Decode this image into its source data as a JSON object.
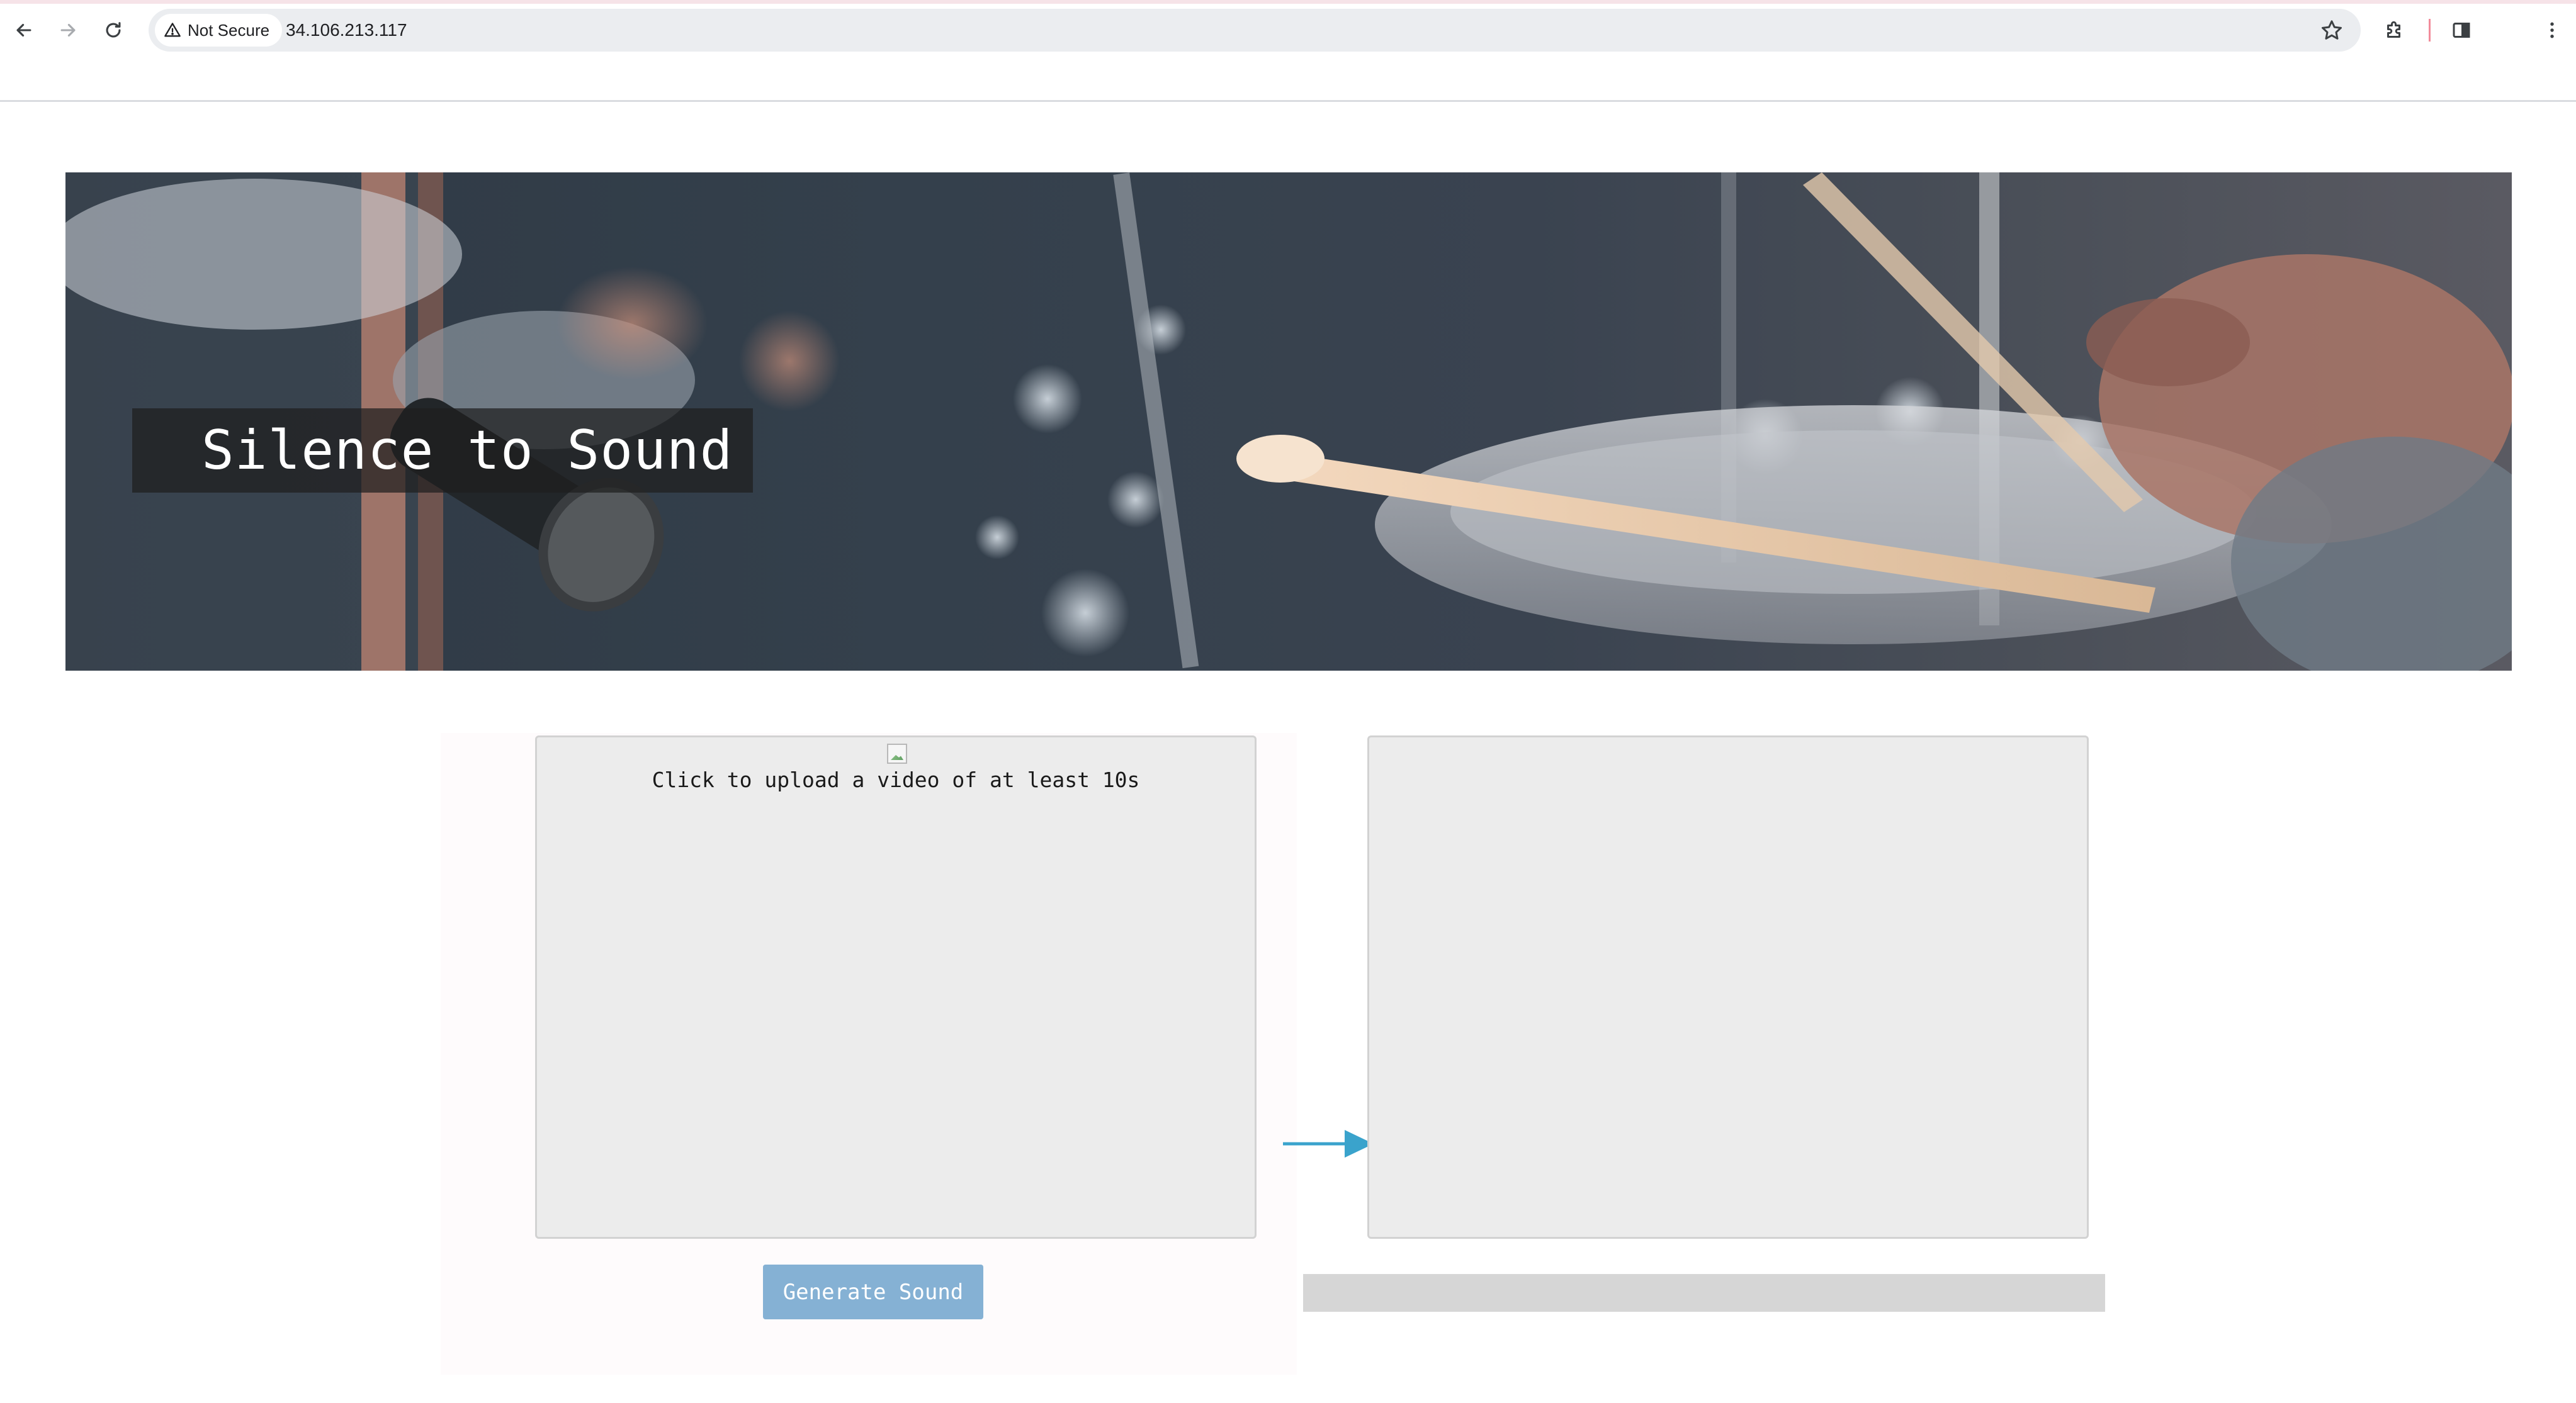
{
  "browser": {
    "security_label": "Not Secure",
    "url": "34.106.213.117"
  },
  "hero": {
    "title": "Silence to Sound"
  },
  "upload_panel": {
    "label": "Click to upload a video of at least 10s"
  },
  "actions": {
    "generate_label": "Generate Sound"
  },
  "progress": {
    "value": 0
  },
  "colors": {
    "arrow": "#3aa3cc",
    "generate_button": "#85b1d4",
    "panel_background": "#ececec",
    "progress_track": "#d6d6d6"
  },
  "icons": {
    "back": "arrow-left-icon",
    "forward": "arrow-right-icon",
    "reload": "reload-icon",
    "warning": "warning-triangle-icon",
    "bookmark": "star-icon",
    "extensions": "puzzle-icon",
    "side_panel": "side-panel-icon",
    "menu": "kebab-menu-icon"
  }
}
